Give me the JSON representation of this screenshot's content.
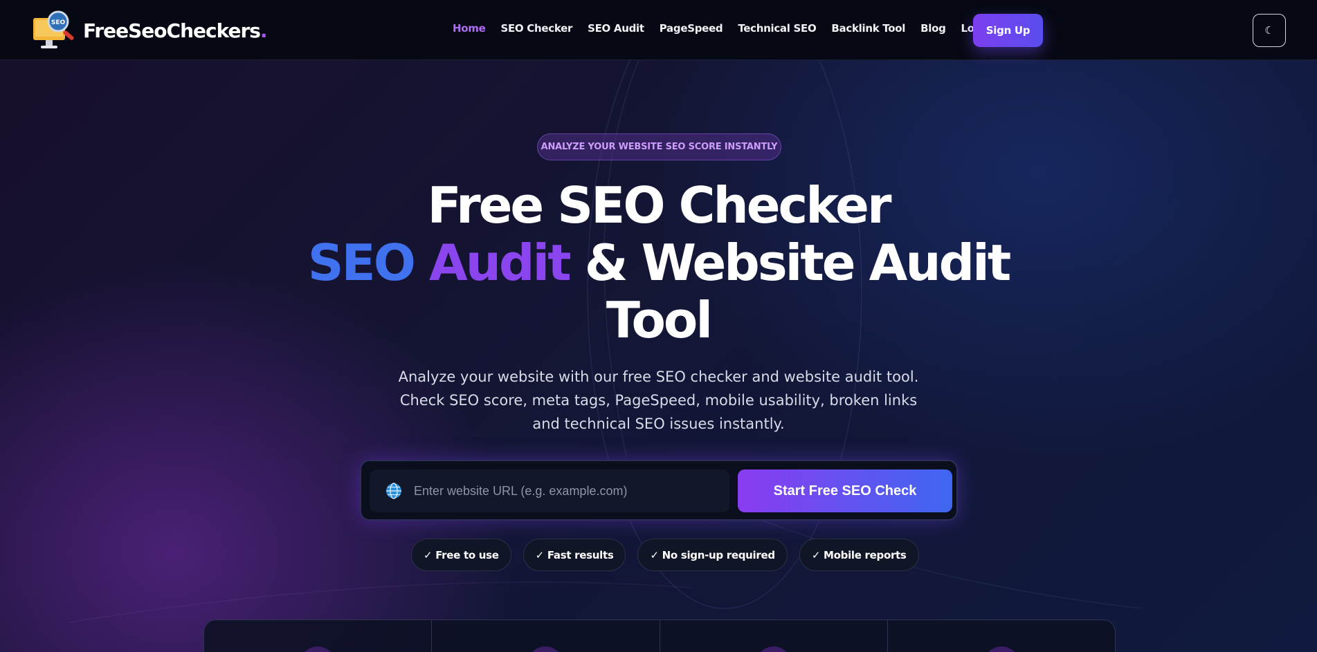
{
  "brand": {
    "name": "FreeSeoCheckers",
    "dot": ".",
    "logo_badge": "SEO"
  },
  "nav": {
    "links": [
      {
        "label": "Home",
        "active": true
      },
      {
        "label": "SEO Checker",
        "active": false
      },
      {
        "label": "SEO Audit",
        "active": false
      },
      {
        "label": "PageSpeed",
        "active": false
      },
      {
        "label": "Technical SEO",
        "active": false
      },
      {
        "label": "Backlink Tool",
        "active": false
      },
      {
        "label": "Blog",
        "active": false
      },
      {
        "label": "Login",
        "active": false
      }
    ],
    "signup_label": "Sign Up",
    "theme_toggle_label": "☾"
  },
  "hero": {
    "pill": "ANALYZE YOUR WEBSITE SEO SCORE INSTANTLY",
    "title_line1": "Free SEO Checker",
    "title_line2_blue": "SEO",
    "title_line2_purple": "Audit",
    "title_line2_rest": "& Website Audit",
    "title_line3": "Tool",
    "subtitle": "Analyze your website with our free SEO checker and website audit tool. Check SEO score, meta tags, PageSpeed, mobile usability, broken links and technical SEO issues instantly.",
    "search": {
      "placeholder": "Enter website URL (e.g. example.com)",
      "value": "",
      "button_label": "Start Free SEO Check"
    },
    "badges": [
      "✓ Free to use",
      "✓ Fast results",
      "✓ No sign-up required",
      "✓ Mobile reports"
    ]
  },
  "colors": {
    "accent_purple": "#8b45ef",
    "accent_blue": "#4071ee",
    "nav_active": "#b06cf5",
    "background": "#0d1128"
  },
  "icons": [
    "logo-monitor-icon",
    "magnifier-icon",
    "globe-icon",
    "moon-icon"
  ]
}
